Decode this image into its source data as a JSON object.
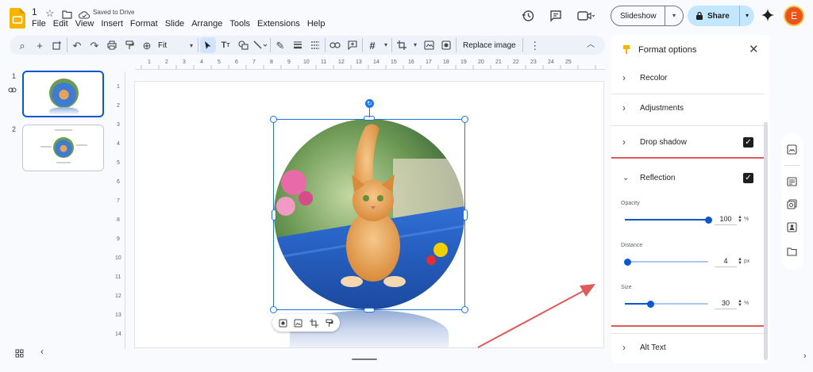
{
  "doc": {
    "title": "1",
    "saved_status": "Saved to Drive",
    "menu": [
      "File",
      "Edit",
      "View",
      "Insert",
      "Format",
      "Slide",
      "Arrange",
      "Tools",
      "Extensions",
      "Help"
    ]
  },
  "header": {
    "slideshow_label": "Slideshow",
    "share_label": "Share",
    "avatar_letter": "E"
  },
  "toolbar": {
    "zoom_value": "Fit",
    "replace_image_label": "Replace image"
  },
  "ruler": {
    "top": [
      "1",
      "2",
      "3",
      "4",
      "5",
      "6",
      "7",
      "8",
      "9",
      "10",
      "11",
      "12",
      "13",
      "14",
      "15",
      "16",
      "17",
      "18",
      "19",
      "20",
      "21",
      "22",
      "23",
      "24",
      "25"
    ],
    "left": [
      "1",
      "2",
      "3",
      "4",
      "5",
      "6",
      "7",
      "8",
      "9",
      "10",
      "11",
      "12",
      "13",
      "14"
    ]
  },
  "slides": [
    {
      "number": "1"
    },
    {
      "number": "2"
    }
  ],
  "format_panel": {
    "title": "Format options",
    "sections": {
      "recolor": "Recolor",
      "adjustments": "Adjustments",
      "drop_shadow": "Drop shadow",
      "reflection": "Reflection",
      "alt_text": "Alt Text"
    },
    "reflection": {
      "opacity": {
        "label": "Opacity",
        "value": "100",
        "unit": "%",
        "fraction": 1.0
      },
      "distance": {
        "label": "Distance",
        "value": "4",
        "unit": "px",
        "fraction": 0.03
      },
      "size": {
        "label": "Size",
        "value": "30",
        "unit": "%",
        "fraction": 0.3
      }
    }
  },
  "colors": {
    "accent": "#0b57d0",
    "share_bg": "#c2e7ff",
    "selection": "#1a73e8",
    "annotation": "#e05a5a",
    "avatar_bg": "#e8541a",
    "slides_logo": "#f6b400"
  }
}
